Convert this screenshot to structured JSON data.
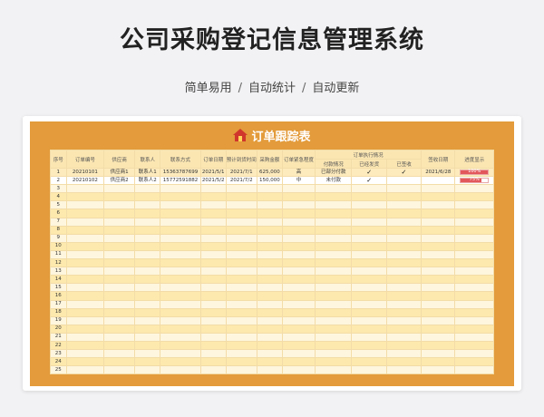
{
  "page": {
    "title": "公司采购登记信息管理系统",
    "tagline": [
      "简单易用",
      "自动统计",
      "自动更新"
    ],
    "separator": "/"
  },
  "sheet": {
    "title": "订单跟踪表",
    "bg_color": "#e39b3b",
    "headers": {
      "index": "序号",
      "order_no": "订单编号",
      "supplier": "供应商",
      "contact": "联系人",
      "contact_method": "联系方式",
      "order_date": "订单日期",
      "expected_date": "预计到货时间",
      "amount": "采购金额",
      "urgency": "订单紧急程度",
      "execution_group": "订单执行情况",
      "payment_status": "付款情况",
      "shipped": "已经发货",
      "received": "已签收",
      "receive_date": "签收日期",
      "progress": "进度显示"
    },
    "rows": [
      {
        "index": "1",
        "order_no": "20210101",
        "supplier": "供应商1",
        "contact": "联系人1",
        "phone": "15363787699",
        "order_date": "2021/5/1",
        "expected_date": "2021/7/1",
        "amount": "625,000",
        "urgency": "高",
        "payment": "已部分付款",
        "shipped": "✓",
        "received": "✓",
        "receive_date": "2021/6/28",
        "progress": 1.0,
        "progress_label": "100%"
      },
      {
        "index": "2",
        "order_no": "20210102",
        "supplier": "供应商2",
        "contact": "联系人2",
        "phone": "15772591882",
        "order_date": "2021/5/2",
        "expected_date": "2021/7/2",
        "amount": "150,000",
        "urgency": "中",
        "payment": "未付款",
        "shipped": "✓",
        "received": "",
        "receive_date": "",
        "progress": 0.75,
        "progress_label": "75%"
      }
    ],
    "empty_rows": [
      "3",
      "4",
      "5",
      "6",
      "7",
      "8",
      "9",
      "10",
      "11",
      "12",
      "13",
      "14",
      "15",
      "16",
      "17",
      "18",
      "19",
      "20",
      "21",
      "22",
      "23",
      "24",
      "25"
    ]
  }
}
